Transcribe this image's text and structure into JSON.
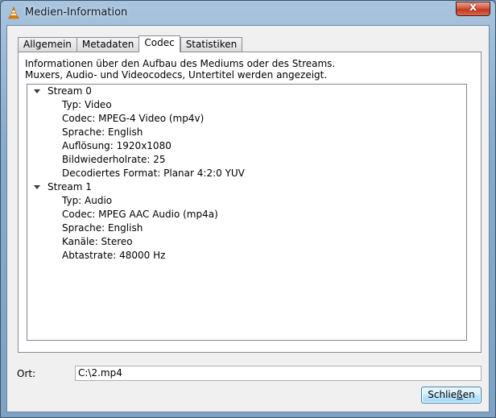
{
  "window": {
    "title": "Medien-Information",
    "close_glyph": "x"
  },
  "tabs": [
    {
      "label": "Allgemein",
      "active": false
    },
    {
      "label": "Metadaten",
      "active": false
    },
    {
      "label": "Codec",
      "active": true
    },
    {
      "label": "Statistiken",
      "active": false
    }
  ],
  "info": {
    "line1": "Informationen über den Aufbau des Mediums oder des Streams.",
    "line2": "Muxers, Audio- und Videocodecs, Untertitel werden angezeigt."
  },
  "streams": [
    {
      "label": "Stream 0",
      "items": [
        "Typ: Video",
        "Codec: MPEG-4 Video (mp4v)",
        "Sprache: English",
        "Auflösung: 1920x1080",
        "Bildwiederholrate: 25",
        "Decodiertes Format: Planar 4:2:0 YUV"
      ]
    },
    {
      "label": "Stream 1",
      "items": [
        "Typ: Audio",
        "Codec: MPEG AAC Audio (mp4a)",
        "Sprache: English",
        "Kanäle: Stereo",
        "Abtastrate: 48000 Hz"
      ]
    }
  ],
  "location": {
    "label": "Ort:",
    "value": "C:\\2.mp4"
  },
  "buttons": {
    "close_prefix": "Schlie",
    "close_underlined": "ß",
    "close_suffix": "en"
  },
  "icons": {
    "app": "vlc-cone-icon",
    "expand": "triangle-down-icon"
  },
  "colors": {
    "title_bar": "#88aacb",
    "close_red": "#c0391f",
    "vlc_orange": "#f08a00"
  }
}
